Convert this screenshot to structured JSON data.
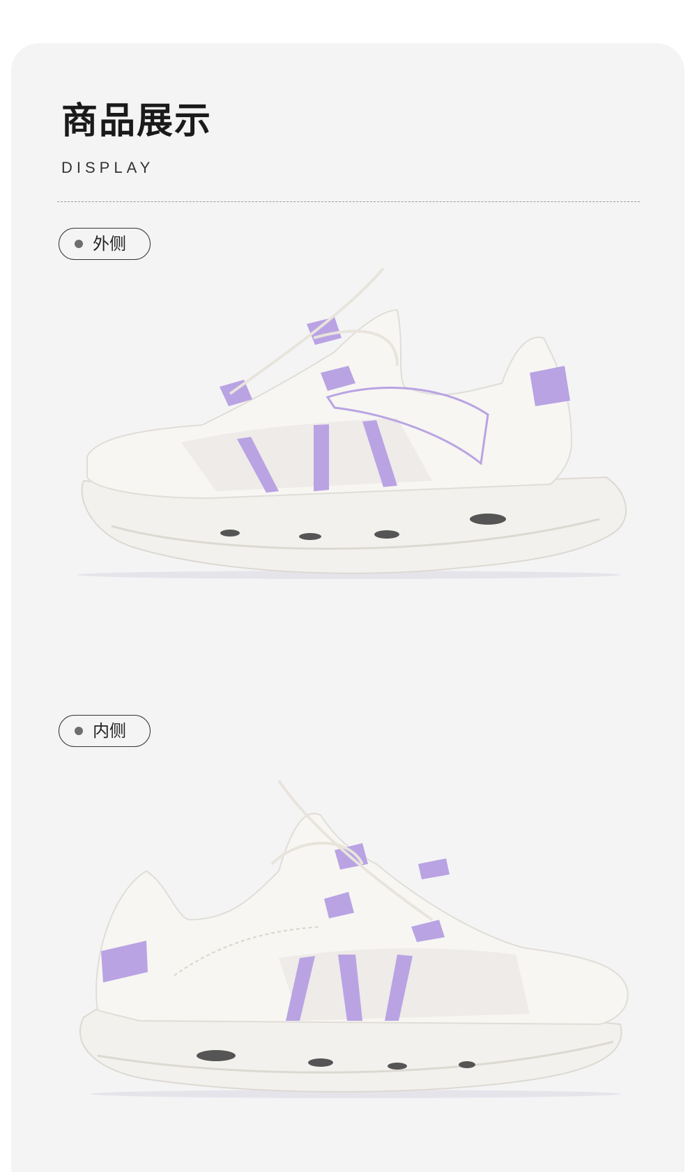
{
  "header": {
    "title": "商品展示",
    "subtitle": "DISPLAY"
  },
  "sections": [
    {
      "label": "外侧",
      "image": "sneaker-lateral-side"
    },
    {
      "label": "内侧",
      "image": "sneaker-medial-side"
    }
  ],
  "colors": {
    "background": "#f4f4f5",
    "accent_lavender": "#b9a3e3",
    "sole": "#f2f0ec"
  }
}
